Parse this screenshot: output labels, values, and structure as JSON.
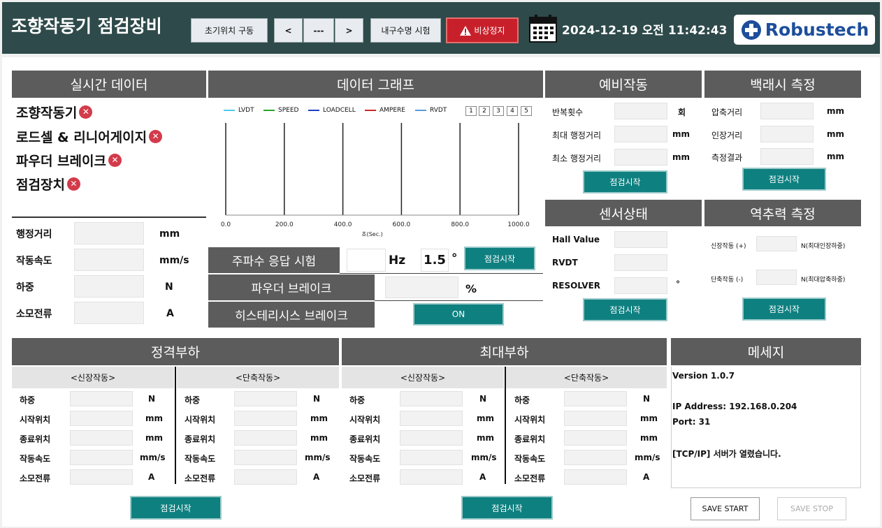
{
  "header": {
    "title": "조향작동기 점검장비",
    "init_button": "초기위치 구동",
    "prev_button": "<",
    "position_display": "---",
    "next_button": ">",
    "durability_button": "내구수명 시험",
    "emergency_button": "비상정지",
    "datetime": "2024-12-19 오전 11:42:43",
    "logo_text": "Robustech"
  },
  "realtime": {
    "title": "실시간 데이터",
    "components": [
      {
        "label": "조향작동기",
        "status": "✕"
      },
      {
        "label": "로드셀 & 리니어게이지",
        "status": "✕"
      },
      {
        "label": "파우더 브레이크",
        "status": "✕"
      },
      {
        "label": "점검장치",
        "status": "✕"
      }
    ],
    "rows": [
      {
        "label": "행정거리",
        "unit": "mm"
      },
      {
        "label": "작동속도",
        "unit": "mm/s"
      },
      {
        "label": "하중",
        "unit": "N"
      },
      {
        "label": "소모전류",
        "unit": "A"
      }
    ]
  },
  "graph": {
    "title": "데이터 그래프",
    "channel_buttons": [
      "1",
      "2",
      "3",
      "4",
      "5"
    ]
  },
  "chart_data": {
    "type": "line",
    "series": [
      {
        "name": "LVDT",
        "color": "#4fc8e8",
        "values": []
      },
      {
        "name": "SPEED",
        "color": "#2aa52a",
        "values": []
      },
      {
        "name": "LOADCELL",
        "color": "#1f3fbf",
        "values": []
      },
      {
        "name": "AMPERE",
        "color": "#c82828",
        "values": []
      },
      {
        "name": "RVDT",
        "color": "#5a9ad8",
        "values": []
      }
    ],
    "xticks": [
      "0.0",
      "200.0",
      "400.0",
      "600.0",
      "800.0",
      "1000.0"
    ],
    "xlabel": "초(Sec.)",
    "xlim": [
      0,
      1000
    ],
    "grid": "vertical"
  },
  "freq": {
    "label": "주파수 응답 시험",
    "hz_unit": "Hz",
    "value": "1.5",
    "deg_unit": "°",
    "button": "점검시작"
  },
  "powder": {
    "label": "파우더 브레이크",
    "unit": "%"
  },
  "hysteresis": {
    "label": "히스테리시스 브레이크",
    "button": "ON"
  },
  "prelim": {
    "title": "예비작동",
    "rows": [
      {
        "label": "반복횟수",
        "unit": "회"
      },
      {
        "label": "최대 행정거리",
        "unit": "mm"
      },
      {
        "label": "최소 행정거리",
        "unit": "mm"
      }
    ],
    "button": "점검시작"
  },
  "backlash": {
    "title": "백래시 측정",
    "rows": [
      {
        "label": "압축거리",
        "unit": "mm"
      },
      {
        "label": "인장거리",
        "unit": "mm"
      },
      {
        "label": "측정결과",
        "unit": "mm"
      }
    ],
    "button": "점검시작"
  },
  "sensor": {
    "title": "센서상태",
    "rows": [
      {
        "label": "Hall Value",
        "unit": ""
      },
      {
        "label": "RVDT",
        "unit": ""
      },
      {
        "label": "RESOLVER",
        "unit": "°"
      }
    ],
    "button": "점검시작"
  },
  "backdrive": {
    "title": "역추력 측정",
    "rows": [
      {
        "label": "신장작동 (+)",
        "unit": "N(최대인장하중)"
      },
      {
        "label": "단축작동 (-)",
        "unit": "N(최대압축하중)"
      }
    ],
    "button": "점검시작"
  },
  "rated": {
    "title": "정격부하",
    "extend_title": "<신장작동>",
    "retract_title": "<단축작동>",
    "rows": [
      {
        "label": "하중",
        "unit": "N"
      },
      {
        "label": "시작위치",
        "unit": "mm"
      },
      {
        "label": "종료위치",
        "unit": "mm"
      },
      {
        "label": "작동속도",
        "unit": "mm/s"
      },
      {
        "label": "소모전류",
        "unit": "A"
      }
    ],
    "button": "점검시작"
  },
  "maxload": {
    "title": "최대부하",
    "extend_title": "<신장작동>",
    "retract_title": "<단축작동>",
    "rows": [
      {
        "label": "하중",
        "unit": "N"
      },
      {
        "label": "시작위치",
        "unit": "mm"
      },
      {
        "label": "종료위치",
        "unit": "mm"
      },
      {
        "label": "작동속도",
        "unit": "mm/s"
      },
      {
        "label": "소모전류",
        "unit": "A"
      }
    ],
    "button": "점검시작"
  },
  "message": {
    "title": "메세지",
    "lines": [
      "Version 1.0.7",
      "IP Address: 192.168.0.204",
      "Port: 31",
      "[TCP/IP] 서버가 열렸습니다."
    ],
    "save_start": "SAVE START",
    "save_stop": "SAVE STOP"
  }
}
